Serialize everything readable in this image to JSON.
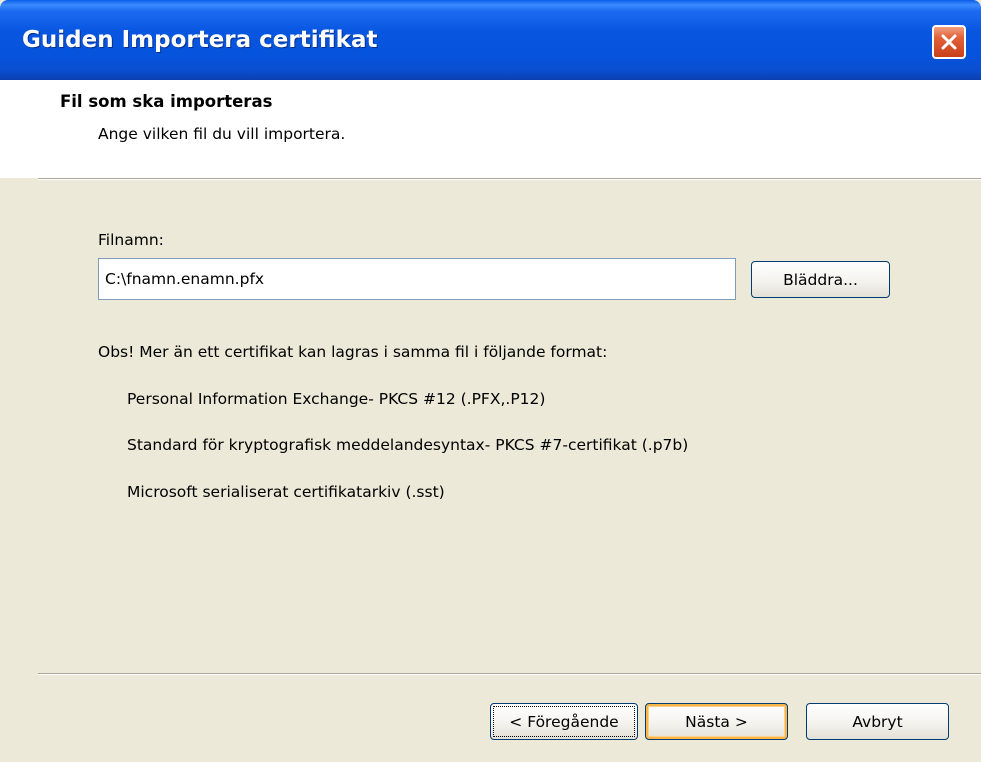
{
  "window": {
    "title": "Guiden Importera certifikat"
  },
  "header": {
    "title": "Fil som ska importeras",
    "subtitle": "Ange vilken fil du vill importera."
  },
  "form": {
    "filename_label": "Filnamn:",
    "filename_value": "C:\\fnamn.enamn.pfx",
    "browse_label": "Bläddra..."
  },
  "note": {
    "intro": "Obs! Mer än ett certifikat kan lagras i samma fil i följande format:",
    "formats": [
      "Personal Information Exchange- PKCS #12 (.PFX,.P12)",
      "Standard för kryptografisk meddelandesyntax- PKCS #7-certifikat (.p7b)",
      "Microsoft serialiserat certifikatarkiv (.sst)"
    ]
  },
  "buttons": {
    "back": "< Föregående",
    "next": "Nästa >",
    "cancel": "Avbryt"
  },
  "icons": {
    "close": "close-icon"
  },
  "colors": {
    "titlebar": "#0653dc",
    "window_bg": "#ece9d8",
    "close_button": "#e2623a",
    "default_button_highlight": "#f8b548"
  }
}
